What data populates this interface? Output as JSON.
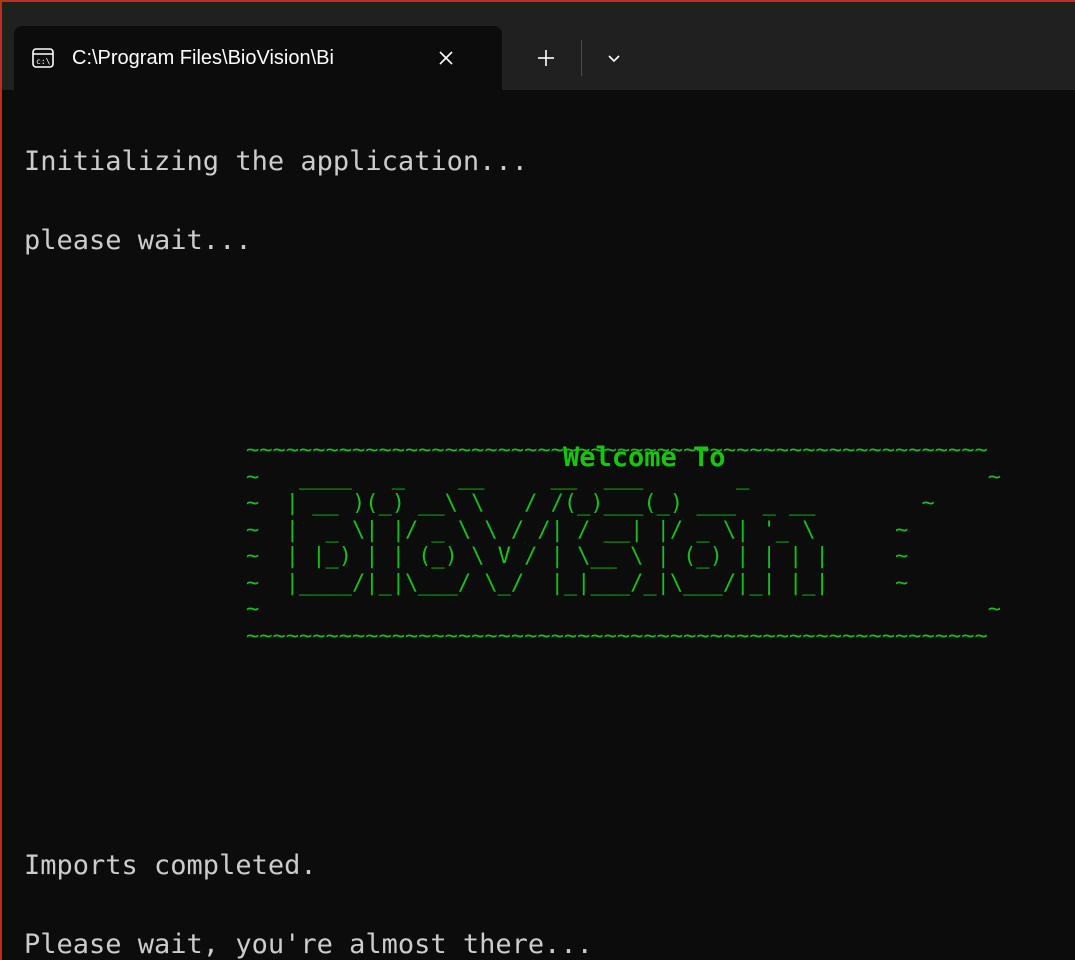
{
  "window": {
    "tab": {
      "icon": "terminal-cmd-icon",
      "title": "C:\\Program Files\\BioVision\\Bi",
      "close_icon": "close-icon"
    },
    "new_tab_icon": "plus-icon",
    "dropdown_icon": "chevron-down-icon",
    "border_color": "#c42b1c"
  },
  "terminal": {
    "background": "#0c0c0c",
    "text_color": "#cccccc",
    "accent_color": "#16c60c",
    "lines": {
      "init": "Initializing the application...",
      "wait": "please wait...",
      "imports": "Imports completed.",
      "almost": "Please wait, you're almost there..."
    },
    "banner": {
      "welcome": "Welcome To",
      "art": [
        "~~~~~~~~~~~~~~~~~~~~~~~~~~~~~~~~~~~~~~~~~~~~~~~~~~~~~~~~",
        "~   ____   _    __     __  ___       _                  ~",
        "~  | __ )(_) __\\ \\   / /(_)___(_) ___  _ __        ~",
        "~  |  _ \\| |/ _ \\ \\ / /| / __| |/ _ \\| '_ \\      ~",
        "~  | |_) | | (_) \\ V / | \\__ \\ | (_) | | | |     ~",
        "~  |____/|_|\\___/ \\_/  |_|___/_|\\___/|_| |_|     ~",
        "~                                                       ~",
        "~~~~~~~~~~~~~~~~~~~~~~~~~~~~~~~~~~~~~~~~~~~~~~~~~~~~~~~~"
      ]
    }
  }
}
